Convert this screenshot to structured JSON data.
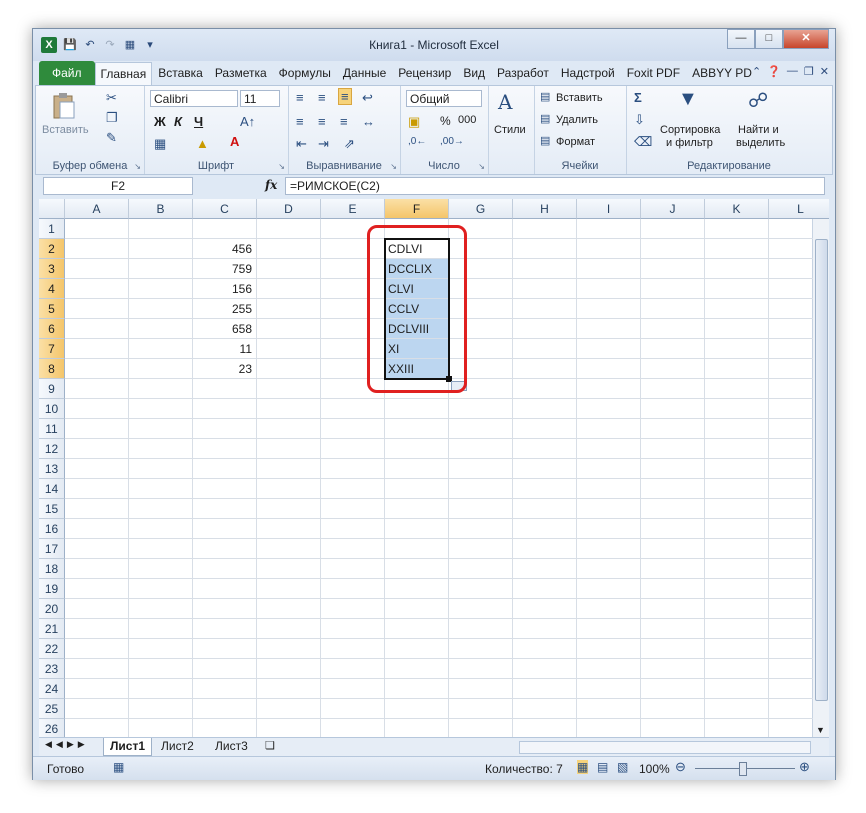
{
  "window": {
    "title": "Книга1 - Microsoft Excel"
  },
  "tabs": [
    "Файл",
    "Главная",
    "Вставка",
    "Разметка",
    "Формулы",
    "Данные",
    "Рецензир",
    "Вид",
    "Разработ",
    "Надстрой",
    "Foxit PDF",
    "ABBYY PD"
  ],
  "active_tab": "Главная",
  "ribbon": {
    "clipboard": {
      "paste": "Вставить",
      "label": "Буфер обмена"
    },
    "font": {
      "name": "Calibri",
      "size": "11",
      "bold": "Ж",
      "italic": "К",
      "underline": "Ч",
      "label": "Шрифт"
    },
    "alignment": {
      "label": "Выравнивание"
    },
    "number": {
      "format": "Общий",
      "percent": "%",
      "thousands": "000",
      "label": "Число"
    },
    "styles": {
      "label": "Стили"
    },
    "cells": {
      "insert": "Вставить",
      "delete": "Удалить",
      "format": "Формат",
      "label": "Ячейки"
    },
    "editing": {
      "sort": "Сортировка",
      "sort2": "и фильтр",
      "find": "Найти и",
      "find2": "выделить",
      "label": "Редактирование"
    }
  },
  "formula_bar": {
    "name_box": "F2",
    "fx": "fx",
    "formula": "=РИМСКОЕ(C2)"
  },
  "columns": [
    "A",
    "B",
    "C",
    "D",
    "E",
    "F",
    "G",
    "H",
    "I",
    "J",
    "K",
    "L"
  ],
  "selected_column": "F",
  "rows": [
    "1",
    "2",
    "3",
    "4",
    "5",
    "6",
    "7",
    "8",
    "9",
    "10",
    "11",
    "12",
    "13",
    "14",
    "15",
    "16",
    "17",
    "18",
    "19",
    "20",
    "21",
    "22",
    "23",
    "24",
    "25",
    "26"
  ],
  "cells": {
    "C": [
      "",
      "456",
      "759",
      "156",
      "255",
      "658",
      "11",
      "23"
    ],
    "F": [
      "",
      "CDLVI",
      "DCCLIX",
      "CLVI",
      "CCLV",
      "DCLVIII",
      "XI",
      "XXIII"
    ]
  },
  "sheets": [
    "Лист1",
    "Лист2",
    "Лист3"
  ],
  "active_sheet": "Лист1",
  "status": {
    "ready": "Готово",
    "count": "Количество: 7",
    "zoom": "100%"
  },
  "colors": {
    "highlight": "#e02020",
    "selection": "#bcd6f0",
    "header_selected": "#f4c56a",
    "file_tab": "#2f8b3c"
  }
}
